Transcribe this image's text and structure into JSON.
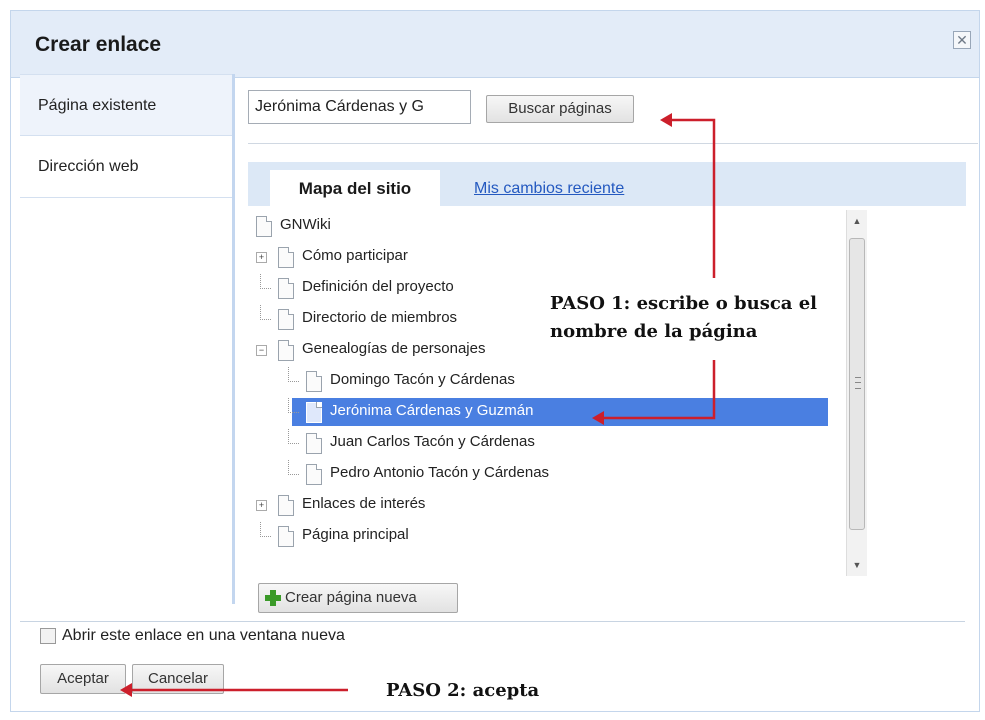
{
  "dialog": {
    "title": "Crear enlace",
    "close_glyph": "✕"
  },
  "nav": {
    "items": [
      {
        "label": "Página existente",
        "selected": true
      },
      {
        "label": "Dirección web",
        "selected": false
      }
    ]
  },
  "search": {
    "value": "Jerónima Cárdenas y G",
    "button_label": "Buscar páginas"
  },
  "tabs": {
    "active_label": "Mapa del sitio",
    "other_label": "Mis cambios reciente"
  },
  "tree": {
    "items": [
      {
        "label": "GNWiki",
        "level": 0,
        "expander": null,
        "selected": false
      },
      {
        "label": "Cómo participar",
        "level": 1,
        "expander": "+",
        "selected": false
      },
      {
        "label": "Definición del proyecto",
        "level": 1,
        "expander": null,
        "selected": false
      },
      {
        "label": "Directorio de miembros",
        "level": 1,
        "expander": null,
        "selected": false
      },
      {
        "label": "Genealogías de personajes",
        "level": 1,
        "expander": "−",
        "selected": false
      },
      {
        "label": "Domingo Tacón y Cárdenas",
        "level": 2,
        "expander": null,
        "selected": false
      },
      {
        "label": "Jerónima Cárdenas y Guzmán",
        "level": 2,
        "expander": null,
        "selected": true
      },
      {
        "label": "Juan Carlos Tacón y Cárdenas",
        "level": 2,
        "expander": null,
        "selected": false
      },
      {
        "label": "Pedro Antonio Tacón y Cárdenas",
        "level": 2,
        "expander": null,
        "selected": false
      },
      {
        "label": "Enlaces de interés",
        "level": 1,
        "expander": "+",
        "selected": false
      },
      {
        "label": "Página principal",
        "level": 1,
        "expander": null,
        "selected": false
      }
    ]
  },
  "new_page_button": "Crear página nueva",
  "open_new_window": {
    "label": "Abrir este enlace en una ventana nueva",
    "checked": false
  },
  "buttons": {
    "ok": "Aceptar",
    "cancel": "Cancelar"
  },
  "annotations": {
    "step1_line1": "PASO 1: escribe o busca el",
    "step1_line2": "nombre de la página",
    "step2": "PASO 2: acepta"
  },
  "colors": {
    "selection": "#4a7fe1",
    "link": "#2459c0",
    "annotation_arrow": "#cc1f2b",
    "accent_border": "#c3d6ef"
  }
}
